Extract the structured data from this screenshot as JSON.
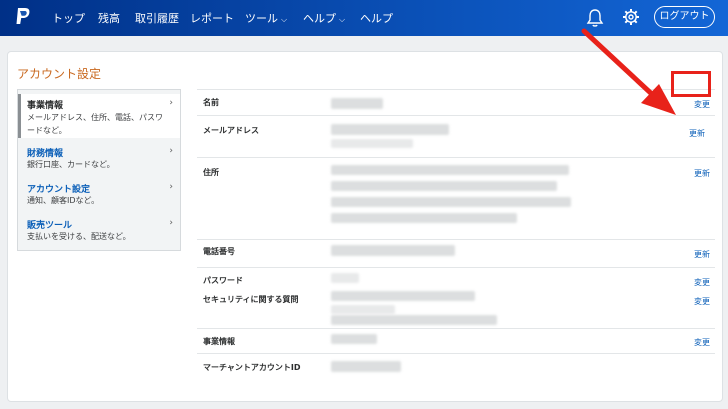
{
  "nav": {
    "items": [
      "トップ",
      "残高",
      "取引履歴",
      "レポート",
      "ツール",
      "ヘルプ",
      "ヘルプ"
    ],
    "logout_label": "ログアウト"
  },
  "card": {
    "title": "アカウント設定"
  },
  "sidebar": {
    "items": [
      {
        "title": "事業情報",
        "desc": "メールアドレス、住所、電話、パスワードなど。"
      },
      {
        "title": "財務情報",
        "desc": "銀行口座、カードなど。"
      },
      {
        "title": "アカウント設定",
        "desc": "通知、顧客IDなど。"
      },
      {
        "title": "販売ツール",
        "desc": "支払いを受ける、配送など。"
      }
    ]
  },
  "rows": {
    "name_label": "名前",
    "email_label": "メールアドレス",
    "address_label": "住所",
    "phone_label": "電話番号",
    "password_label": "パスワード",
    "security_label": "セキュリティに関する質問",
    "business_label": "事業情報",
    "merchant_label": "マーチャントアカウントID",
    "change_label": "変更",
    "update_label": "更新"
  },
  "colors": {
    "accent_orange": "#c9681f",
    "link_blue": "#0b5fb8",
    "highlight_red": "#e8221a",
    "nav_blue": "#003087"
  }
}
